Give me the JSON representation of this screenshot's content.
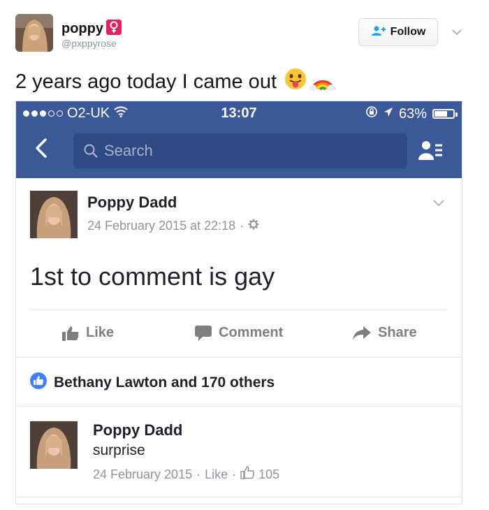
{
  "tweet": {
    "author_name": "poppy",
    "author_handle": "@pxppyrose",
    "follow_label": "Follow",
    "text": "2 years ago today I came out",
    "emojis": [
      "tongue-face-emoji",
      "rainbow-emoji"
    ]
  },
  "phone": {
    "carrier": "O2-UK",
    "time": "13:07",
    "battery": "63%",
    "battery_level": 0.63,
    "search_placeholder": "Search"
  },
  "post": {
    "author": "Poppy Dadd",
    "timestamp": "24 February 2015 at 22:18",
    "text": "1st to comment is gay",
    "actions": {
      "like": "Like",
      "comment": "Comment",
      "share": "Share"
    },
    "likes_summary": "Bethany Lawton and 170 others"
  },
  "comment": {
    "author": "Poppy Dadd",
    "text": "surprise",
    "date": "24 February 2015",
    "like_label": "Like",
    "like_count": "105"
  },
  "colors": {
    "facebook_blue": "#3b5998",
    "twitter_pink": "#e0245e",
    "like_blue": "#4080ff"
  }
}
